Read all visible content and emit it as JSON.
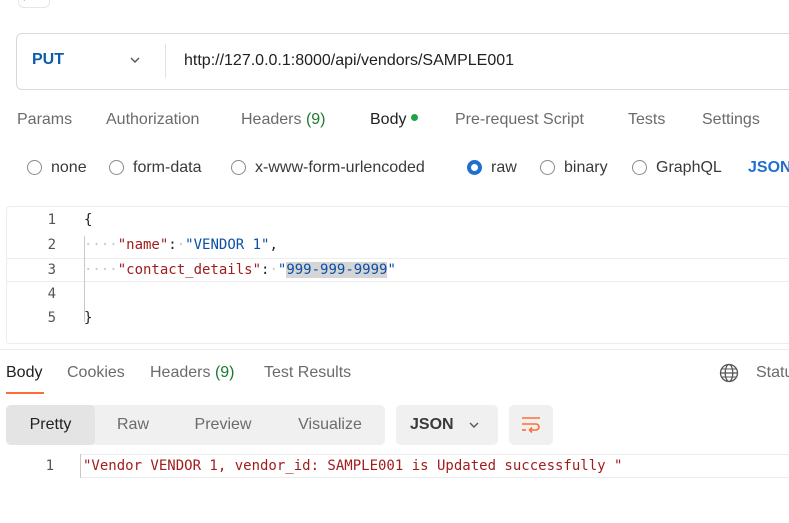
{
  "request": {
    "method": "PUT",
    "url": "http://127.0.0.1:8000/api/vendors/SAMPLE001"
  },
  "request_tabs": {
    "params": "Params",
    "authorization": "Authorization",
    "headers_label": "Headers",
    "headers_count": "(9)",
    "body": "Body",
    "pre_request": "Pre-request Script",
    "tests": "Tests",
    "settings": "Settings"
  },
  "body_types": {
    "none": "none",
    "form_data": "form-data",
    "urlencoded": "x-www-form-urlencoded",
    "raw": "raw",
    "binary": "binary",
    "graphql": "GraphQL",
    "format": "JSON",
    "selected": "raw"
  },
  "editor": {
    "line_numbers": [
      "1",
      "2",
      "3",
      "4",
      "5"
    ],
    "open_brace": "{",
    "close_brace": "}",
    "name_key": "\"name\"",
    "name_value": "\"VENDOR 1\"",
    "contact_key": "\"contact_details\"",
    "contact_value_quote_open": "\"",
    "contact_value_selected": "999-999-9999",
    "contact_value_quote_close": "\""
  },
  "response_tabs": {
    "body": "Body",
    "cookies": "Cookies",
    "headers_label": "Headers",
    "headers_count": "(9)",
    "test_results": "Test Results",
    "status_label": "Statu"
  },
  "view_modes": {
    "pretty": "Pretty",
    "raw": "Raw",
    "preview": "Preview",
    "visualize": "Visualize",
    "format": "JSON"
  },
  "response": {
    "line_number": "1",
    "text": "\"Vendor VENDOR 1, vendor_id: SAMPLE001 is Updated successfully \""
  },
  "colors": {
    "accent_orange": "#ff6c37",
    "method_blue": "#0b5cad",
    "radio_blue": "#1f6fd1",
    "body_dot_green": "#1fa34a",
    "json_key_red": "#a11d1d",
    "json_string_blue": "#0b4fa8"
  },
  "icons": [
    "chevron-down-icon",
    "globe-icon",
    "wrap-lines-icon",
    "back-arrow-icon"
  ]
}
